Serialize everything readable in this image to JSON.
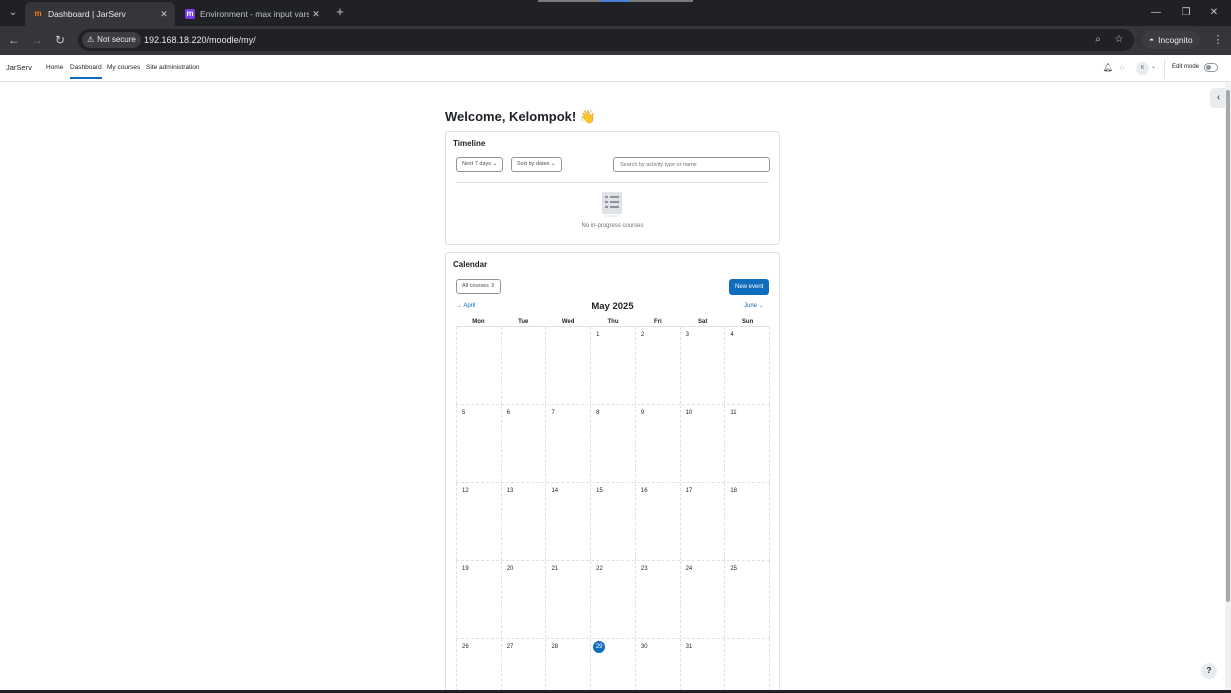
{
  "browser": {
    "tabs": [
      {
        "title": "Dashboard | JarServ",
        "favicon": "m",
        "active": true
      },
      {
        "title": "Environment - max input vars",
        "favicon": "m",
        "active": false
      }
    ],
    "security_label": "Not secure",
    "url": "192.168.18.220/moodle/my/",
    "incognito_label": "Incognito"
  },
  "navbar": {
    "brand": "JarServ",
    "links": [
      "Home",
      "Dashboard",
      "My courses",
      "Site administration"
    ],
    "avatar_initials": "K",
    "edit_mode_label": "Edit mode"
  },
  "page": {
    "welcome": "Welcome, Kelompok! 👋"
  },
  "timeline": {
    "title": "Timeline",
    "filter_label": "Next 7 days",
    "sort_label": "Sort by dates",
    "search_placeholder": "Search by activity type or name",
    "empty_text": "No in-progress courses"
  },
  "calendar": {
    "title": "Calendar",
    "course_filter": "All courses",
    "new_event_label": "New event",
    "month": "May 2025",
    "prev_month": "April",
    "next_month": "June",
    "weekdays": [
      "Mon",
      "Tue",
      "Wed",
      "Thu",
      "Fri",
      "Sat",
      "Sun"
    ],
    "weeks": [
      [
        "",
        "",
        "",
        "1",
        "2",
        "3",
        "4"
      ],
      [
        "5",
        "6",
        "7",
        "8",
        "9",
        "10",
        "11"
      ],
      [
        "12",
        "13",
        "14",
        "15",
        "16",
        "17",
        "18"
      ],
      [
        "19",
        "20",
        "21",
        "22",
        "23",
        "24",
        "25"
      ],
      [
        "26",
        "27",
        "28",
        "29",
        "30",
        "31",
        ""
      ]
    ],
    "today": "29"
  },
  "colors": {
    "primary": "#0f6cbf",
    "browser_dark": "#202124",
    "browser_toolbar": "#35363a"
  },
  "help_label": "?"
}
